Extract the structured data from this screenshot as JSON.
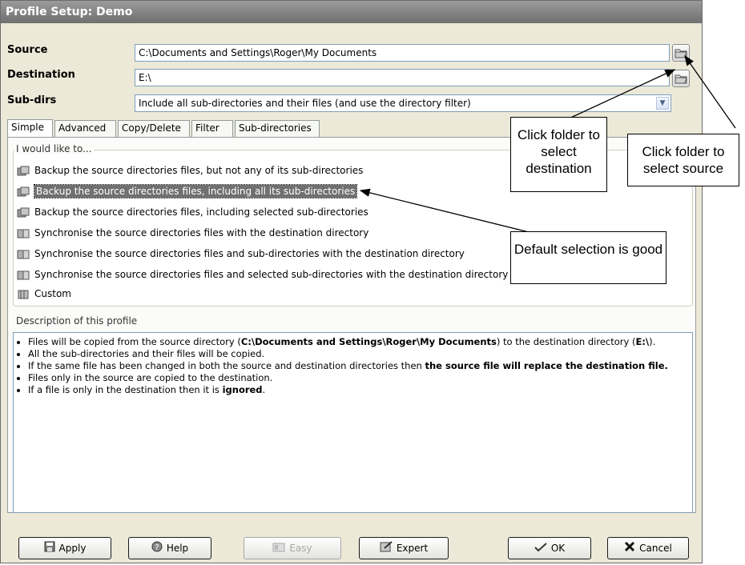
{
  "window": {
    "title": "Profile Setup: Demo"
  },
  "source": {
    "label": "Source",
    "value": "C:\\Documents and Settings\\Roger\\My Documents"
  },
  "destination": {
    "label": "Destination",
    "value": "E:\\"
  },
  "subdirs": {
    "label": "Sub-dirs",
    "value": "Include all sub-directories and their files (and use the directory filter)"
  },
  "tabs": [
    "Simple",
    "Advanced",
    "Copy/Delete",
    "Filter",
    "Sub-directories"
  ],
  "options_group": {
    "legend": "I would like to...",
    "items": [
      "Backup the source directories files, but not any of its sub-directories",
      "Backup the source directories files, including all its sub-directories",
      "Backup the source directories files, including selected sub-directories",
      "Synchronise the source directories files with the destination directory",
      "Synchronise the source directories files and sub-directories with the destination directory",
      "Synchronise the source directories files and selected sub-directories with the destination directory",
      "Custom"
    ],
    "selected_index": 1
  },
  "description": {
    "legend": "Description of this profile",
    "line1_pre": "Files will be copied from the source directory (",
    "line1_path": "C:\\Documents and Settings\\Roger\\My Documents",
    "line1_mid": ") to the destination directory (",
    "line1_dest": "E:\\",
    "line1_post": ").",
    "line2": "All the sub-directories and their files will be copied.",
    "line3_pre": "If the same file has been changed in both the source and destination directories then ",
    "line3_bold": "the source file will replace the destination file.",
    "line4": "Files only in the source are copied to the destination.",
    "line5_pre": "If a file is only in the destination then it is ",
    "line5_bold": "ignored",
    "line5_post": "."
  },
  "buttons": {
    "apply": "Apply",
    "help": "Help",
    "easy": "Easy",
    "expert": "Expert",
    "ok": "OK",
    "cancel": "Cancel"
  },
  "callouts": {
    "destination": "Click folder to select destination",
    "source": "Click folder to select source",
    "default": "Default selection is good"
  }
}
